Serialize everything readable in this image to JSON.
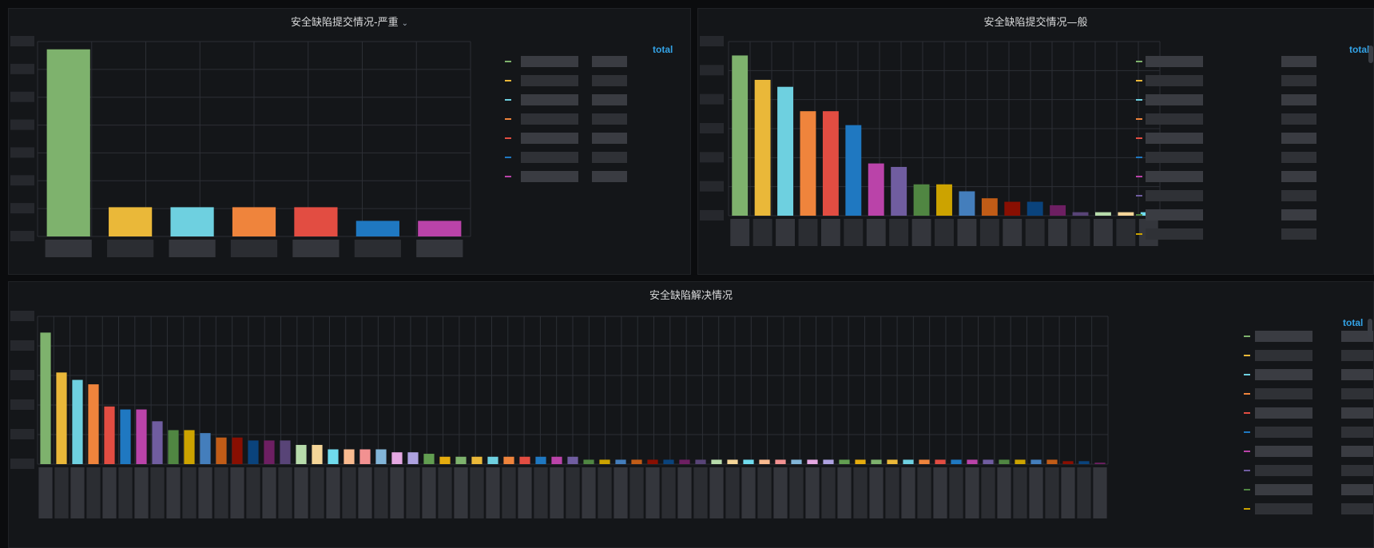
{
  "panels": [
    {
      "id": "p1",
      "title": "安全缺陷提交情况-严重",
      "has_chevron": true,
      "legend_header": "total",
      "chevron_icon": "chevron-down-icon"
    },
    {
      "id": "p2",
      "title": "安全缺陷提交情况—般",
      "has_chevron": false,
      "legend_header": "total"
    },
    {
      "id": "p3",
      "title": "安全缺陷解决情况",
      "has_chevron": false,
      "legend_header": "total"
    }
  ],
  "palette": [
    "#7eb26d",
    "#eab839",
    "#6ed0e0",
    "#ef843c",
    "#e24d42",
    "#1f78c1",
    "#ba43a9",
    "#705da0",
    "#508642",
    "#cca300",
    "#447ebc",
    "#c15c17",
    "#890f02",
    "#0a437c",
    "#6d1f62",
    "#584477",
    "#b7dbab",
    "#f4d598",
    "#70dbed",
    "#f9ba8f",
    "#f29191",
    "#82b5d8",
    "#e5a8e2",
    "#aea2e0",
    "#629e51",
    "#e5ac0e"
  ],
  "chart_data": [
    {
      "type": "bar",
      "title": "安全缺陷提交情况-严重",
      "legend_header": "total",
      "ylim": [
        0,
        100
      ],
      "grid": true,
      "legend_placement": "right",
      "values": [
        96,
        15,
        15,
        15,
        15,
        8,
        8
      ]
    },
    {
      "type": "bar",
      "title": "安全缺陷提交情况—般",
      "legend_header": "total",
      "ylim": [
        0,
        100
      ],
      "grid": true,
      "legend_placement": "right",
      "values": [
        92,
        78,
        74,
        60,
        60,
        52,
        30,
        28,
        18,
        18,
        14,
        10,
        8,
        8,
        6,
        2,
        2,
        2,
        2
      ]
    },
    {
      "type": "bar",
      "title": "安全缺陷解决情况",
      "legend_header": "total",
      "ylim": [
        0,
        100
      ],
      "grid": true,
      "legend_placement": "right",
      "values": [
        89,
        62,
        57,
        54,
        39,
        37,
        37,
        29,
        23,
        23,
        21,
        18,
        18,
        16,
        16,
        16,
        13,
        13,
        10,
        10,
        10,
        10,
        8,
        8,
        7,
        5,
        5,
        5,
        5,
        5,
        5,
        5,
        5,
        5,
        3,
        3,
        3,
        3,
        3,
        3,
        3,
        3,
        3,
        3,
        3,
        3,
        3,
        3,
        3,
        3,
        3,
        3,
        3,
        3,
        3,
        3,
        3,
        3,
        3,
        3,
        3,
        3,
        3,
        3,
        2,
        2,
        1
      ]
    }
  ]
}
